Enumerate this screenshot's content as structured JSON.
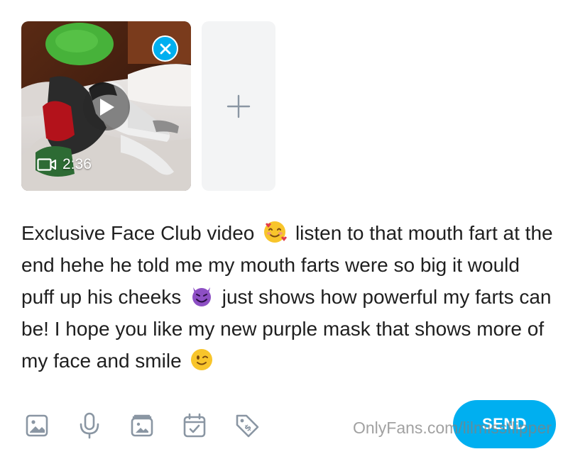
{
  "media": {
    "duration": "2:36",
    "remove_icon": "close-icon",
    "play_icon": "play-icon",
    "video_icon": "video-camera-icon",
    "add_icon": "plus-icon"
  },
  "caption": {
    "part1": "Exclusive Face Club video",
    "emoji1": "smiling-face-with-hearts",
    "part2": "listen to that mouth fart at the end hehe he told me my mouth farts were so big it would puff up his cheeks",
    "emoji2": "smiling-face-with-horns",
    "part3": "just shows how powerful my farts can be! I hope you like my new purple mask that shows more of my face and smile",
    "emoji3": "winking-face"
  },
  "toolbar": {
    "icons": [
      "image-icon",
      "microphone-icon",
      "media-vault-icon",
      "calendar-check-icon",
      "price-tag-icon"
    ],
    "send_label": "SEND"
  },
  "watermark": "OnlyFans.com/lilmissflipper",
  "colors": {
    "accent": "#00aff0",
    "icon_gray": "#8a96a3",
    "tile_bg": "#f3f4f5"
  }
}
